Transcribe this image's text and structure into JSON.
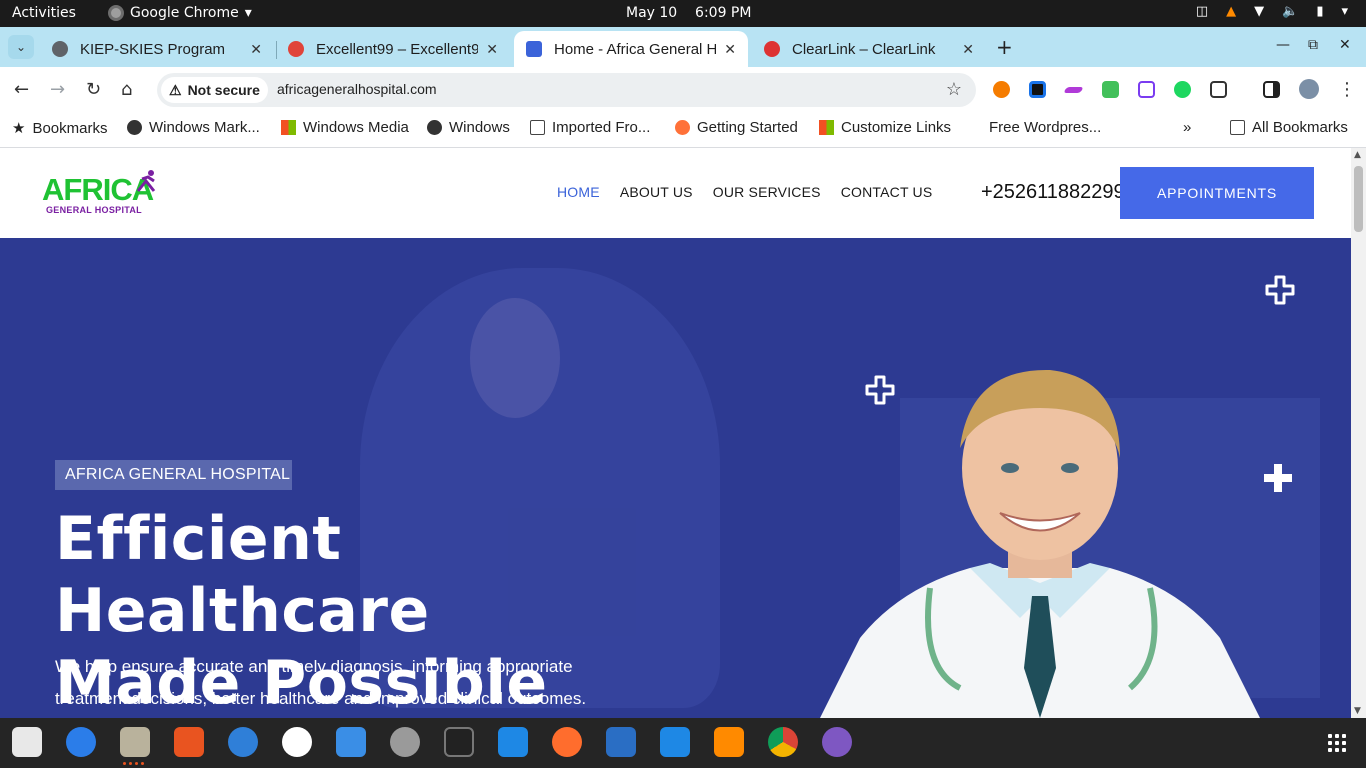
{
  "system_bar": {
    "activities": "Activities",
    "app_name": "Google Chrome",
    "date": "May 10",
    "time": "6:09 PM"
  },
  "tabs": [
    {
      "title": "KIEP-SKIES Program",
      "active": false
    },
    {
      "title": "Excellent99 – Excellent9",
      "active": false
    },
    {
      "title": "Home - Africa General Ho",
      "active": true
    },
    {
      "title": "ClearLink – ClearLink",
      "active": false
    }
  ],
  "omnibox": {
    "security_label": "Not secure",
    "url": "africageneralhospital.com"
  },
  "bookmarks": [
    {
      "label": "Bookmarks",
      "icon": "star-icon"
    },
    {
      "label": "Windows Mark...",
      "icon": "globe-icon"
    },
    {
      "label": "Windows Media",
      "icon": "windows-icon"
    },
    {
      "label": "Windows",
      "icon": "globe-icon"
    },
    {
      "label": "Imported Fro...",
      "icon": "folder-icon"
    },
    {
      "label": "Getting Started",
      "icon": "firefox-icon"
    },
    {
      "label": "Customize Links",
      "icon": "windows-icon"
    },
    {
      "label": "Free Wordpres...",
      "icon": ""
    }
  ],
  "bookmarks_overflow": "»",
  "all_bookmarks": "All Bookmarks",
  "site": {
    "logo_big": "AFRICA",
    "logo_small": "GENERAL HOSPITAL",
    "nav": [
      "HOME",
      "ABOUT US",
      "OUR SERVICES",
      "CONTACT US"
    ],
    "phone": "+252611882299",
    "cta": "APPOINTMENTS",
    "hero": {
      "badge": "AFRICA GENERAL HOSPITAL",
      "headline_line1": "Efficient Healthcare",
      "headline_line2": "Made Possible",
      "lead_line1": "We help ensure accurate and timely diagnosis, informing appropriate",
      "lead_line2": "treatment decisions, better healthcare and improved clinical outcomes."
    }
  },
  "colors": {
    "hero_bg": "#2d3a92",
    "accent_blue": "#4569e8",
    "logo_green": "#1fc233",
    "logo_purple": "#7a1fa2",
    "tabstrip_bg": "#b8e3f3"
  }
}
